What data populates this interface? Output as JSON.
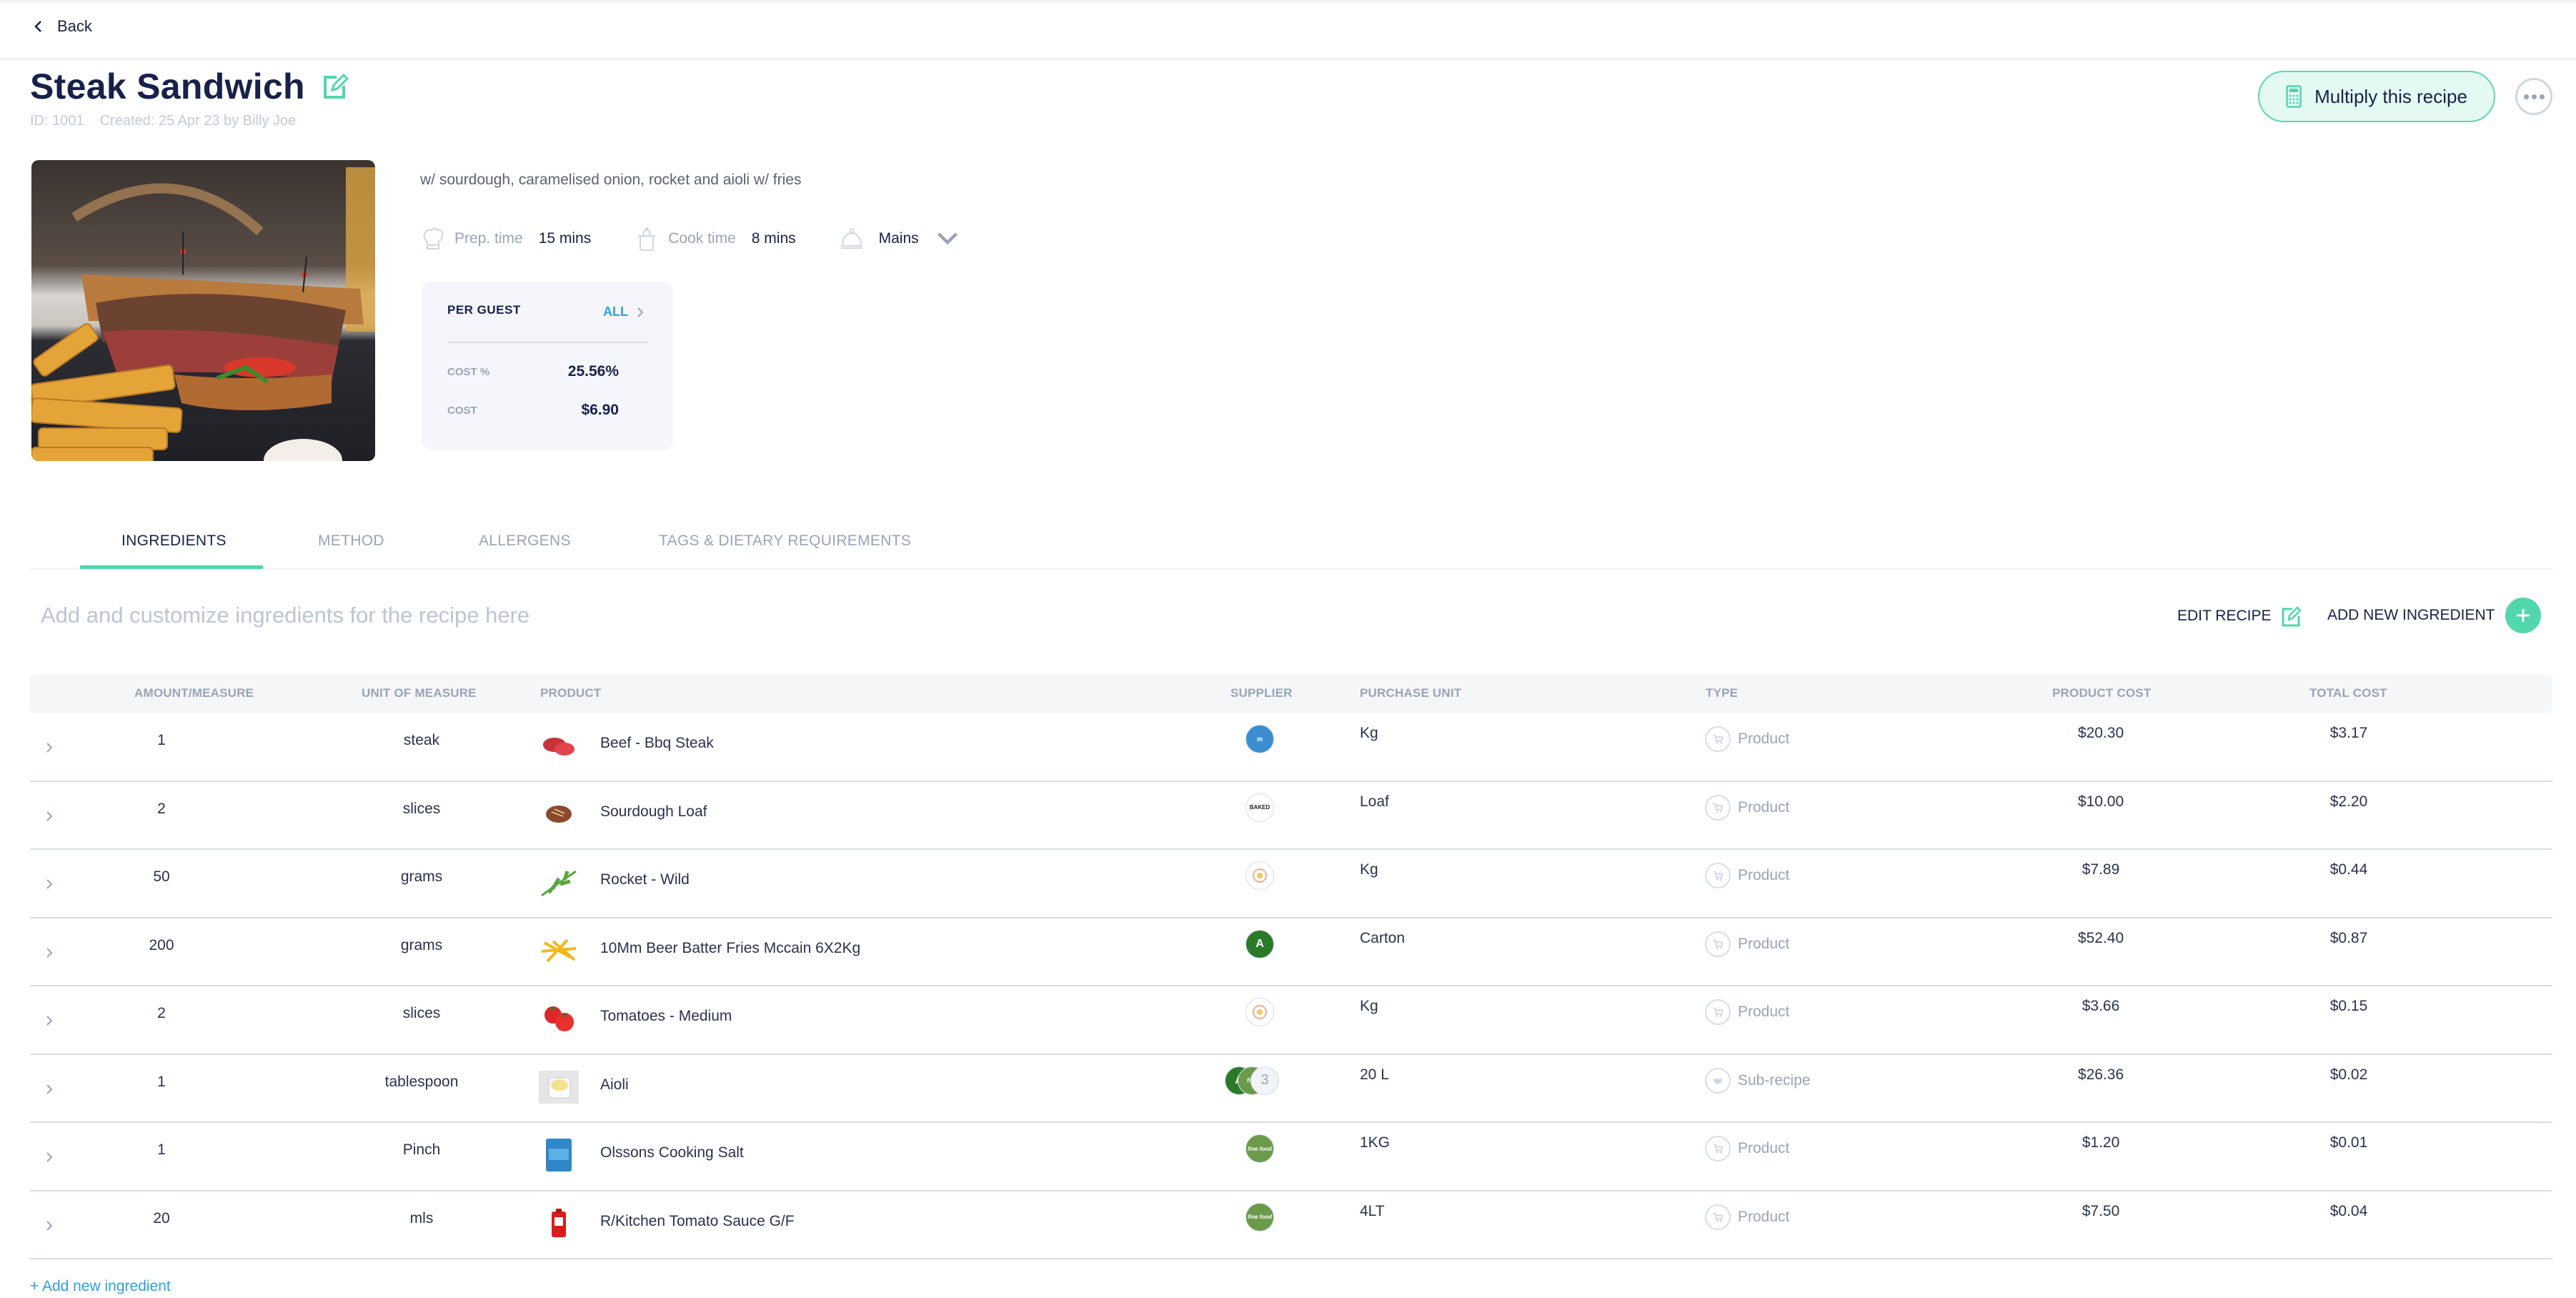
{
  "nav": {
    "back_label": "Back"
  },
  "recipe": {
    "title": "Steak Sandwich",
    "id_label": "ID: 1001",
    "created_label": "Created: 25 Apr 23 by Billy Joe",
    "description": "w/ sourdough, caramelised onion, rocket and aioli w/ fries",
    "prep_label": "Prep. time",
    "prep_value": "15 mins",
    "cook_label": "Cook time",
    "cook_value": "8 mins",
    "category": "Mains"
  },
  "actions": {
    "multiply_label": "Multiply this recipe",
    "edit_recipe_label": "EDIT RECIPE",
    "add_ingredient_label": "ADD NEW INGREDIENT",
    "add_link_label": "+ Add new ingredient"
  },
  "per_guest": {
    "heading": "PER GUEST",
    "all_label": "ALL",
    "cost_pct_label": "COST %",
    "cost_pct_value": "25.56%",
    "cost_label": "COST",
    "cost_value": "$6.90"
  },
  "tabs": [
    {
      "label": "INGREDIENTS",
      "active": true
    },
    {
      "label": "METHOD",
      "active": false
    },
    {
      "label": "ALLERGENS",
      "active": false
    },
    {
      "label": "TAGS & DIETARY REQUIREMENTS",
      "active": false
    }
  ],
  "ingredients_hint": "Add and customize ingredients for the recipe here",
  "table": {
    "columns": [
      "AMOUNT/MEASURE",
      "UNIT OF MEASURE",
      "PRODUCT",
      "SUPPLIER",
      "PURCHASE UNIT",
      "TYPE",
      "PRODUCT COST",
      "TOTAL COST"
    ],
    "rows": [
      {
        "amount": "1",
        "unit": "steak",
        "product": "Beef - Bbq Steak",
        "thumb": "steak",
        "supplier": "hm-blue",
        "purchase_unit": "Kg",
        "type": "Product",
        "product_cost": "$20.30",
        "total_cost": "$3.17"
      },
      {
        "amount": "2",
        "unit": "slices",
        "product": "Sourdough Loaf",
        "thumb": "bread",
        "supplier": "baked",
        "purchase_unit": "Loaf",
        "type": "Product",
        "product_cost": "$10.00",
        "total_cost": "$2.20"
      },
      {
        "amount": "50",
        "unit": "grams",
        "product": "Rocket - Wild",
        "thumb": "rocket",
        "supplier": "fresh",
        "purchase_unit": "Kg",
        "type": "Product",
        "product_cost": "$7.89",
        "total_cost": "$0.44"
      },
      {
        "amount": "200",
        "unit": "grams",
        "product": "10Mm Beer Batter Fries Mccain 6X2Kg",
        "thumb": "fries",
        "supplier": "ka-foods",
        "purchase_unit": "Carton",
        "type": "Product",
        "product_cost": "$52.40",
        "total_cost": "$0.87"
      },
      {
        "amount": "2",
        "unit": "slices",
        "product": "Tomatoes - Medium",
        "thumb": "tomato",
        "supplier": "fresh",
        "purchase_unit": "Kg",
        "type": "Product",
        "product_cost": "$3.66",
        "total_cost": "$0.15"
      },
      {
        "amount": "1",
        "unit": "tablespoon",
        "product": "Aioli",
        "thumb": "aioli",
        "supplier": "multi",
        "supplier_count": "3",
        "purchase_unit": "20 L",
        "type": "Sub-recipe",
        "product_cost": "$26.36",
        "total_cost": "$0.02"
      },
      {
        "amount": "1",
        "unit": "Pinch",
        "product": "Olssons Cooking Salt",
        "thumb": "salt",
        "supplier": "finefood",
        "purchase_unit": "1KG",
        "type": "Product",
        "product_cost": "$1.20",
        "total_cost": "$0.01"
      },
      {
        "amount": "20",
        "unit": "mls",
        "product": "R/Kitchen Tomato Sauce G/F",
        "thumb": "sauce",
        "supplier": "finefood",
        "purchase_unit": "4LT",
        "type": "Product",
        "product_cost": "$7.50",
        "total_cost": "$0.04"
      }
    ]
  },
  "colors": {
    "accent": "#52d6ac",
    "link": "#2ea0e0",
    "text": "#17214a",
    "muted": "#9aa4b8"
  }
}
